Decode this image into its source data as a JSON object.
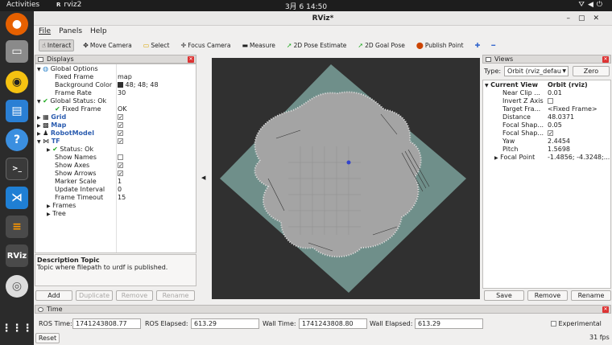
{
  "system": {
    "activities": "Activities",
    "app_name": "rviz2",
    "clock": "3月 6  14:50"
  },
  "window": {
    "title": "RViz*"
  },
  "menu": [
    "File",
    "Panels",
    "Help"
  ],
  "toolbar": {
    "interact": "Interact",
    "move_camera": "Move Camera",
    "select": "Select",
    "focus_camera": "Focus Camera",
    "measure": "Measure",
    "pose_estimate": "2D Pose Estimate",
    "goal_pose": "2D Goal Pose",
    "publish_point": "Publish Point"
  },
  "displays": {
    "title": "Displays",
    "rows": {
      "global_options": "Global Options",
      "fixed_frame_label": "Fixed Frame",
      "fixed_frame_value": "map",
      "bg_color_label": "Background Color",
      "bg_color_value": "48; 48; 48",
      "frame_rate_label": "Frame Rate",
      "frame_rate_value": "30",
      "global_status": "Global Status: Ok",
      "gs_fixed_frame": "Fixed Frame",
      "gs_fixed_frame_value": "OK",
      "grid": "Grid",
      "map": "Map",
      "robot_model": "RobotModel",
      "tf": "TF",
      "tf_status": "Status: Ok",
      "show_names": "Show Names",
      "show_axes": "Show Axes",
      "show_arrows": "Show Arrows",
      "marker_scale": "Marker Scale",
      "marker_scale_value": "1",
      "update_interval": "Update Interval",
      "update_interval_value": "0",
      "frame_timeout": "Frame Timeout",
      "frame_timeout_value": "15",
      "frames": "Frames",
      "tree": "Tree"
    },
    "desc_title": "Description Topic",
    "desc_text": "Topic where filepath to urdf is published.",
    "buttons": {
      "add": "Add",
      "duplicate": "Duplicate",
      "remove": "Remove",
      "rename": "Rename"
    }
  },
  "views": {
    "title": "Views",
    "type_label": "Type:",
    "type_value": "Orbit (rviz_defau",
    "zero": "Zero",
    "current_view": "Current View",
    "current_view_value": "Orbit (rviz)",
    "rows": [
      {
        "label": "Near Clip ...",
        "value": "0.01"
      },
      {
        "label": "Invert Z Axis",
        "value": ""
      },
      {
        "label": "Target Fra...",
        "value": "<Fixed Frame>"
      },
      {
        "label": "Distance",
        "value": "48.0371"
      },
      {
        "label": "Focal Shap...",
        "value": "0.05"
      },
      {
        "label": "Focal Shap...",
        "value": ""
      },
      {
        "label": "Yaw",
        "value": "2.4454"
      },
      {
        "label": "Pitch",
        "value": "1.5698"
      },
      {
        "label": "Focal Point",
        "value": "-1.4856; -4.3248;..."
      }
    ],
    "buttons": {
      "save": "Save",
      "remove": "Remove",
      "rename": "Rename"
    }
  },
  "time": {
    "title": "Time",
    "ros_time_label": "ROS Time:",
    "ros_time": "1741243808.77",
    "ros_elapsed_label": "ROS Elapsed:",
    "ros_elapsed": "613.29",
    "wall_time_label": "Wall Time:",
    "wall_time": "1741243808.80",
    "wall_elapsed_label": "Wall Elapsed:",
    "wall_elapsed": "613.29",
    "experimental": "Experimental",
    "reset": "Reset",
    "fps": "31 fps"
  },
  "colors": {
    "background": "#303030",
    "map_free": "#a4a4a4",
    "map_unknown": "#6f8f8a",
    "accent": "#e95420"
  }
}
